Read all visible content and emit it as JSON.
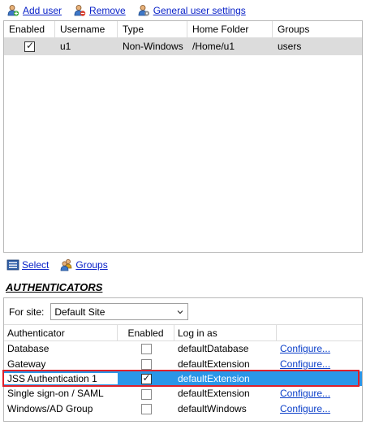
{
  "toolbar": {
    "add_user": "Add user",
    "remove": "Remove",
    "general_settings": "General user settings"
  },
  "users_grid": {
    "columns": [
      "Enabled",
      "Username",
      "Type",
      "Home Folder",
      "Groups"
    ],
    "rows": [
      {
        "enabled": true,
        "username": "u1",
        "type": "Non-Windows",
        "home_folder": "/Home/u1",
        "groups": "users"
      }
    ]
  },
  "bottombar": {
    "select": "Select",
    "groups": "Groups"
  },
  "authenticators": {
    "title": "AUTHENTICATORS",
    "for_site_label": "For site:",
    "site_value": "Default Site",
    "columns": [
      "Authenticator",
      "Enabled",
      "Log in as"
    ],
    "rows": [
      {
        "name": "Database",
        "enabled": false,
        "login_as": "defaultDatabase",
        "configure": "Configure..."
      },
      {
        "name": "Gateway",
        "enabled": false,
        "login_as": "defaultExtension",
        "configure": "Configure..."
      },
      {
        "name": "JSS Authentication 1",
        "enabled": true,
        "login_as": "defaultExtension",
        "configure": ""
      },
      {
        "name": "Single sign-on / SAML",
        "enabled": false,
        "login_as": "defaultExtension",
        "configure": "Configure..."
      },
      {
        "name": "Windows/AD Group",
        "enabled": false,
        "login_as": "defaultWindows",
        "configure": "Configure..."
      }
    ]
  },
  "colors": {
    "link": "#0a22c8",
    "selection": "#2a96e8",
    "highlight": "#e0202a"
  }
}
